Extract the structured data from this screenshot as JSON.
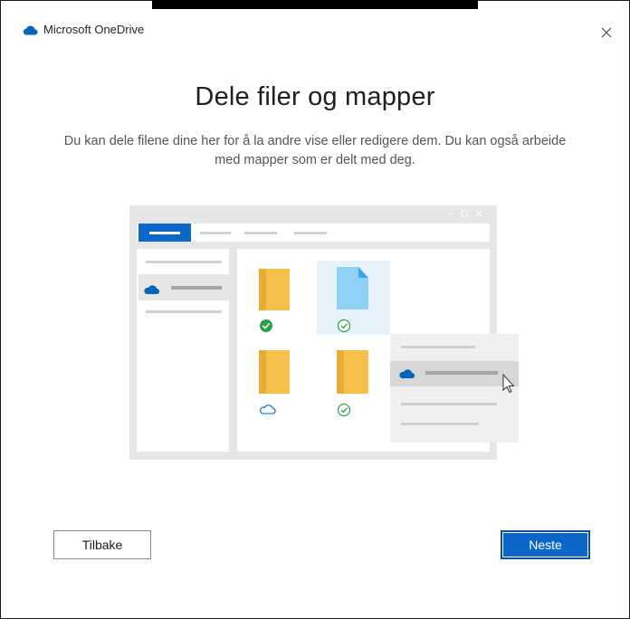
{
  "window": {
    "title": "Microsoft OneDrive",
    "close_label": "×"
  },
  "content": {
    "heading": "Dele filer og mapper",
    "subtitle": "Du kan dele filene dine her for å la andre vise eller redigere dem. Du kan også arbeide med mapper som er delt med deg."
  },
  "buttons": {
    "back_label": "Tilbake",
    "next_label": "Neste"
  },
  "colors": {
    "accent": "#0a67c7",
    "onedrive_blue": "#0364b8",
    "folder_yellow": "#f7c04a",
    "success_green": "#2ea043"
  },
  "illustration": {
    "icons": [
      "onedrive-cloud-icon",
      "folder-icon",
      "file-icon",
      "check-icon",
      "cloud-outline-icon",
      "cursor-icon"
    ]
  }
}
